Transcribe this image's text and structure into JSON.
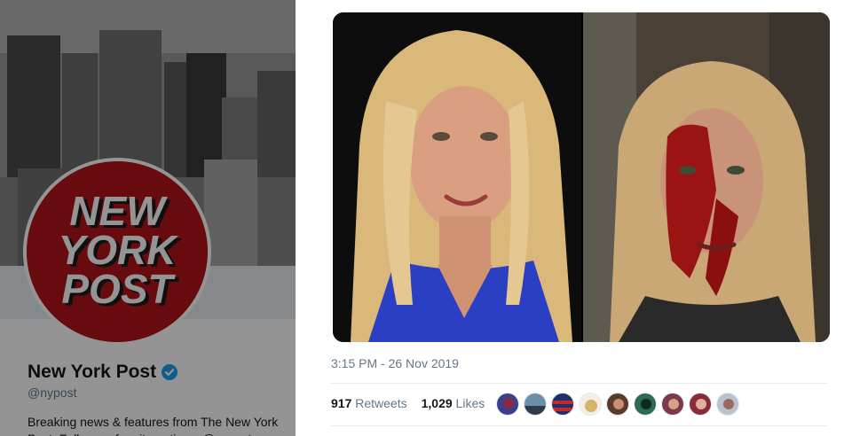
{
  "profile": {
    "name": "New York Post",
    "handle": "@nypost",
    "bio": "Breaking news & features from The New York Post. Follow us for site notices: @nypost",
    "logo_lines": [
      "NEW",
      "YORK",
      "POST"
    ],
    "brand_color": "#b3141a",
    "verified_color": "#1da1f2"
  },
  "tweet": {
    "timestamp": "3:15 PM - 26 Nov 2019",
    "retweets_count": "917",
    "retweets_label": "Retweets",
    "likes_count": "1,029",
    "likes_label": "Likes",
    "liker_avatars": [
      "avatar-1",
      "avatar-2",
      "avatar-3",
      "avatar-4",
      "avatar-5",
      "avatar-6",
      "avatar-7",
      "avatar-8",
      "avatar-9"
    ]
  },
  "colors": {
    "secondary_text": "#657786",
    "divider": "#e6ecf0"
  }
}
